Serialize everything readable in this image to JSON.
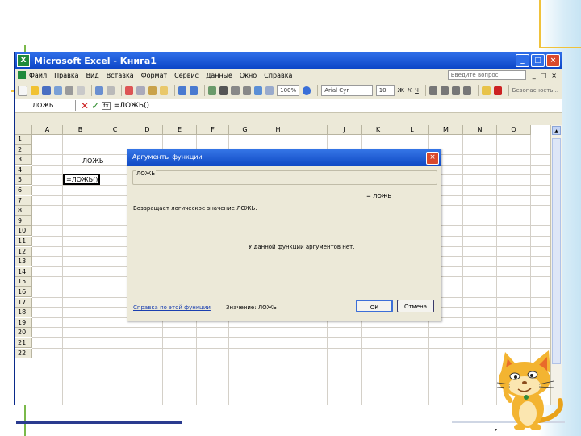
{
  "window": {
    "title": "Microsoft Excel - Книга1",
    "min": "_",
    "max": "□",
    "close": "×"
  },
  "menu": {
    "items": [
      "Файл",
      "Правка",
      "Вид",
      "Вставка",
      "Формат",
      "Сервис",
      "Данные",
      "Окно",
      "Справка"
    ],
    "help_placeholder": "Введите вопрос",
    "doc_min": "_",
    "doc_max": "□",
    "doc_close": "×"
  },
  "toolbar": {
    "zoom": "100%",
    "font_name": "Arial Cyr",
    "font_size": "10",
    "bold": "Ж",
    "italic": "К",
    "underline": "Ч",
    "security": "Безопасность..."
  },
  "formula_bar": {
    "name_box": "ЛОЖЬ",
    "cancel": "✕",
    "enter": "✓",
    "fx": "fx",
    "formula": "=ЛОЖЬ()"
  },
  "sheet": {
    "columns": [
      "A",
      "B",
      "C",
      "D",
      "E",
      "F",
      "G",
      "H",
      "I",
      "J",
      "K",
      "L",
      "M",
      "N",
      "O"
    ],
    "rows": [
      "1",
      "2",
      "3",
      "4",
      "5",
      "6",
      "7",
      "8",
      "9",
      "10",
      "11",
      "12",
      "13",
      "14",
      "15",
      "16",
      "17",
      "18",
      "19",
      "20",
      "21",
      "22"
    ],
    "cell_b2": "ЛОЖЬ",
    "cell_b4": "=ЛОЖЬ()"
  },
  "dialog": {
    "title": "Аргументы функции",
    "close": "×",
    "function_name": "ЛОЖЬ",
    "result_eq": "= ЛОЖЬ",
    "description": "Возвращает логическое значение ЛОЖЬ.",
    "no_args": "У данной функции аргументов нет.",
    "help_link": "Справка по этой функции",
    "value_label": "Значение: ЛОЖЬ",
    "ok": "ОК",
    "cancel": "Отмена"
  }
}
